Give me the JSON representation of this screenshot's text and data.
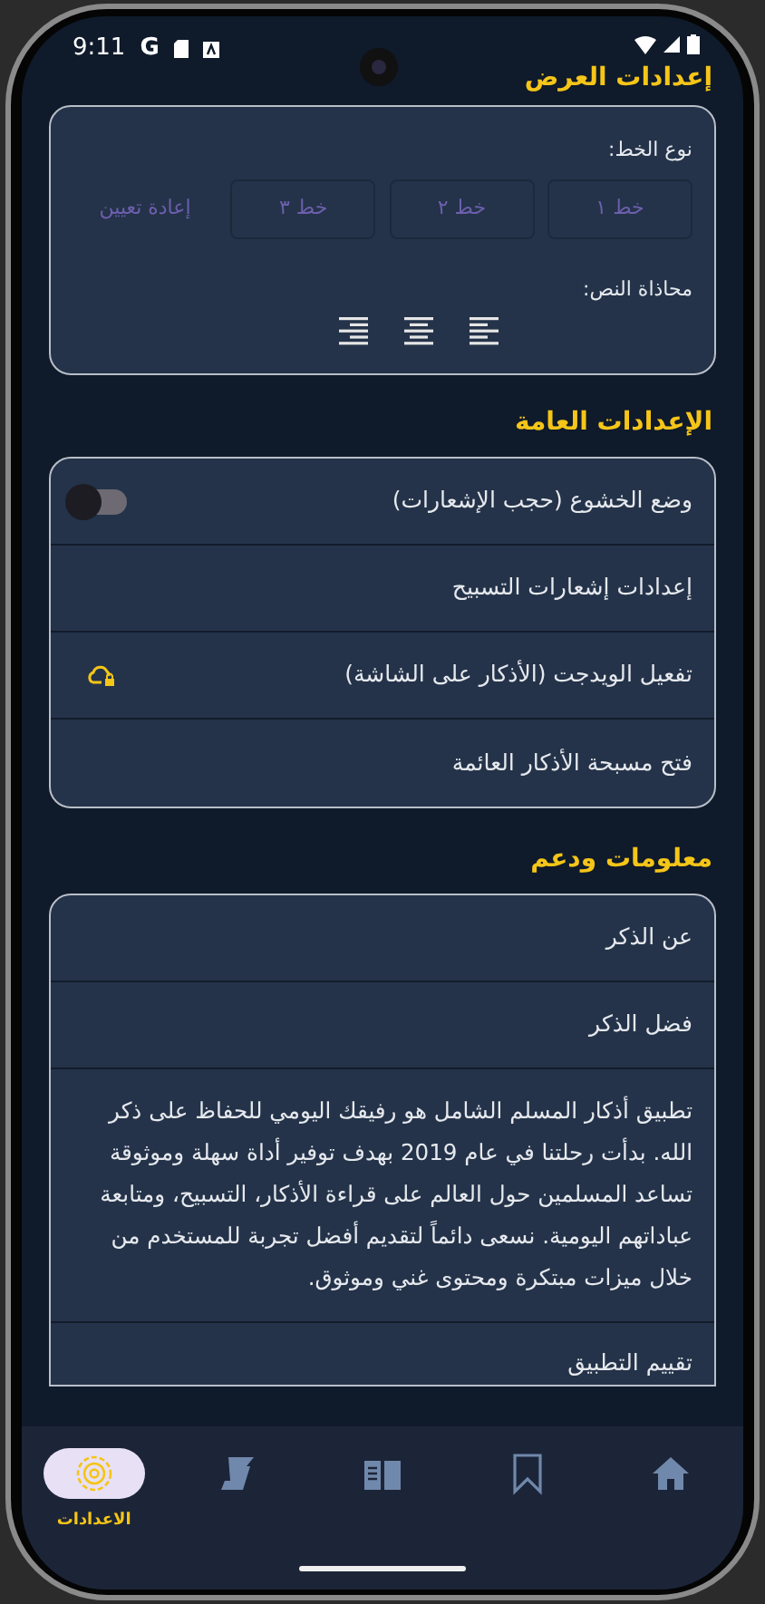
{
  "status_bar": {
    "time": "9:11",
    "carrier_mark": "G"
  },
  "display_settings": {
    "title": "إعدادات العرض",
    "font_label": "نوع الخط:",
    "font_buttons": [
      {
        "label": "خط ١",
        "kind": "outlined"
      },
      {
        "label": "خط ٢",
        "kind": "outlined"
      },
      {
        "label": "خط ٣",
        "kind": "outlined"
      },
      {
        "label": "إعادة تعيين",
        "kind": "text"
      }
    ],
    "align_label": "محاذاة النص:",
    "align_options": [
      {
        "kind": "left"
      },
      {
        "kind": "center"
      },
      {
        "kind": "right"
      }
    ]
  },
  "general_settings": {
    "title": "الإعدادات العامة",
    "items": [
      {
        "kind": "toggle",
        "label": "وضع الخشوع (حجب الإشعارات)",
        "on": false
      },
      {
        "kind": "link",
        "label": "إعدادات إشعارات التسبيح"
      },
      {
        "kind": "locked",
        "label": "تفعيل الويدجت (الأذكار على الشاشة)"
      },
      {
        "kind": "link",
        "label": "فتح مسبحة الأذكار العائمة"
      }
    ]
  },
  "info_support": {
    "title": "معلومات ودعم",
    "items": [
      {
        "kind": "link",
        "label": "عن الذكر"
      },
      {
        "kind": "link",
        "label": "فضل الذكر"
      },
      {
        "kind": "paragraph",
        "label": "تطبيق أذكار المسلم الشامل هو رفيقك اليومي للحفاظ على ذكر الله. بدأت رحلتنا في عام 2019 بهدف توفير أداة سهلة وموثوقة تساعد المسلمين حول العالم على قراءة الأذكار، التسبيح، ومتابعة عباداتهم اليومية. نسعى دائماً لتقديم أفضل تجربة للمستخدم من خلال ميزات مبتكرة ومحتوى غني وموثوق."
      },
      {
        "kind": "link",
        "label": "تقييم التطبيق"
      }
    ]
  },
  "bottom_nav": [
    {
      "kind": "settings",
      "label": "الاعدادات",
      "selected": true
    },
    {
      "kind": "scroll",
      "selected": false
    },
    {
      "kind": "book",
      "selected": false
    },
    {
      "kind": "bookmark",
      "selected": false
    },
    {
      "kind": "home",
      "selected": false
    }
  ]
}
